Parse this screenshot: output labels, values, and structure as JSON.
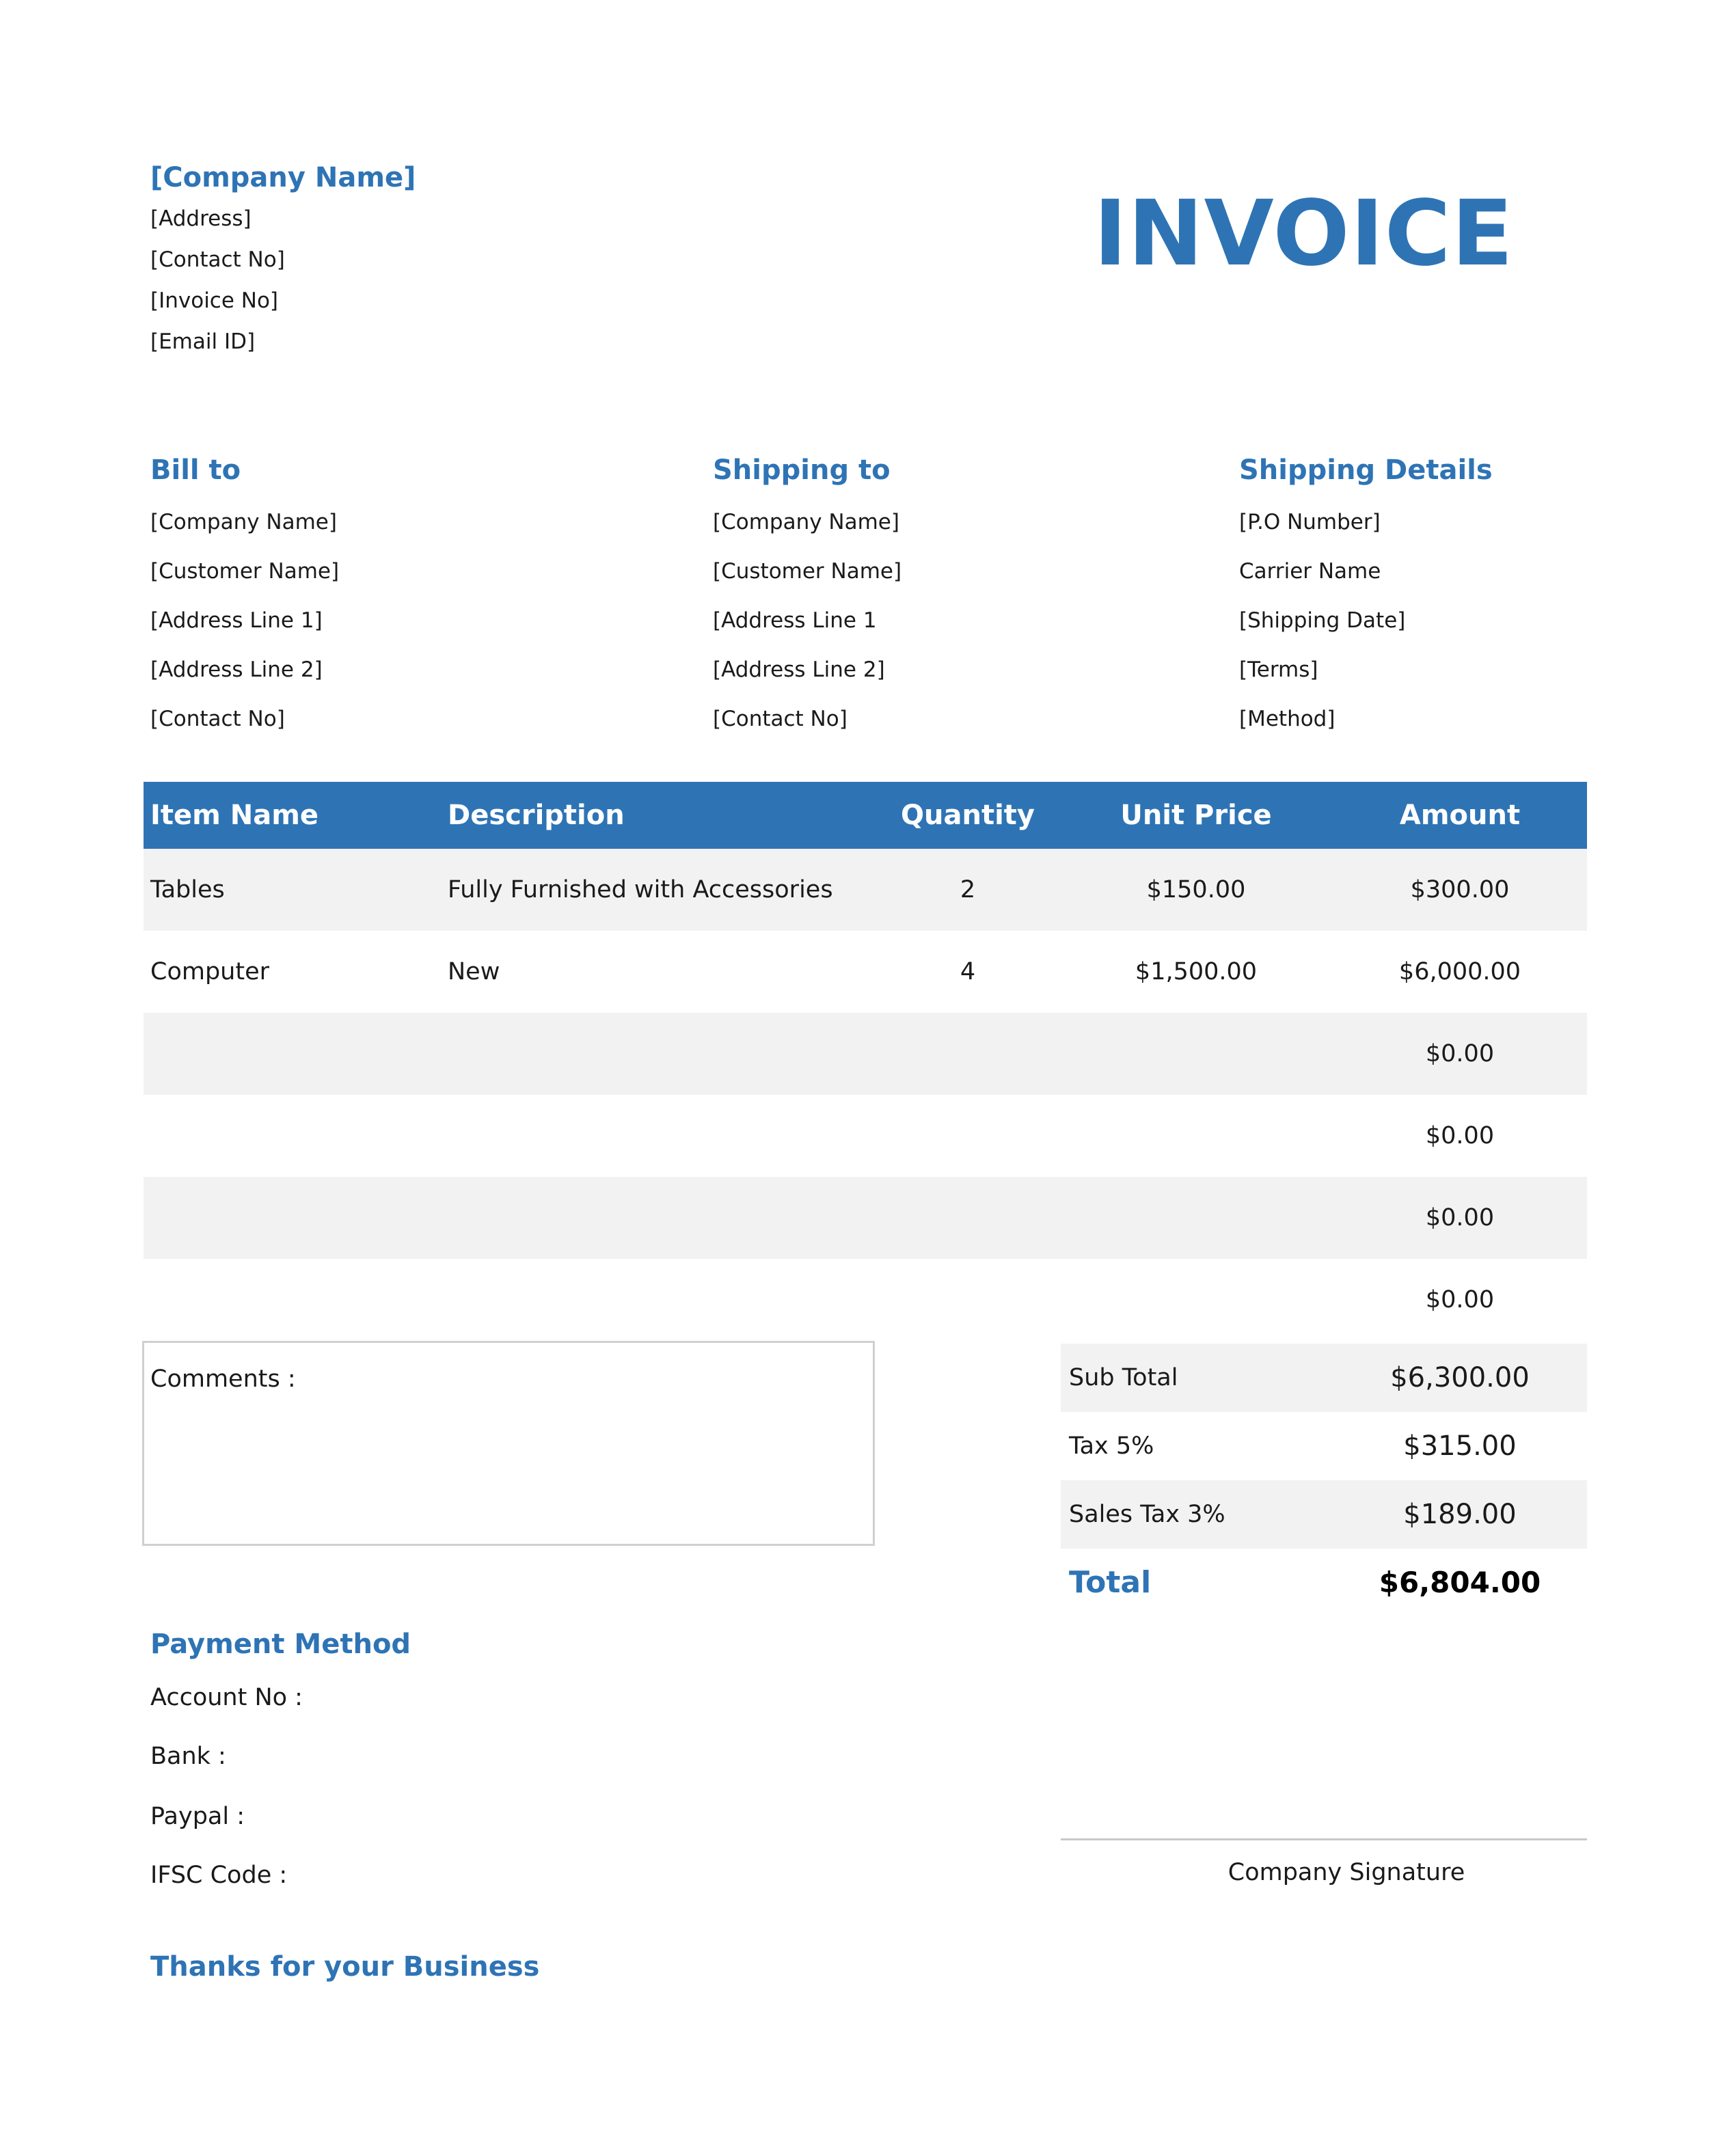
{
  "header": {
    "company_name": "[Company Name]",
    "address": "[Address]",
    "contact": "[Contact No]",
    "invoice_no": "[Invoice No]",
    "email": "[Email ID]",
    "title": "INVOICE"
  },
  "bill_to": {
    "heading": "Bill to",
    "lines": [
      "[Company Name]",
      "[Customer Name]",
      "[Address Line 1]",
      "[Address Line 2]",
      "[Contact No]"
    ]
  },
  "shipping_to": {
    "heading": "Shipping to",
    "lines": [
      "[Company Name]",
      "[Customer Name]",
      "[Address Line 1",
      "[Address Line 2]",
      "[Contact No]"
    ]
  },
  "shipping_details": {
    "heading": "Shipping Details",
    "lines": [
      "[P.O Number]",
      "Carrier Name",
      "[Shipping Date]",
      "[Terms]",
      "[Method]"
    ]
  },
  "table": {
    "headers": [
      "Item Name",
      "Description",
      "Quantity",
      "Unit Price",
      "Amount"
    ],
    "rows": [
      {
        "item": "Tables",
        "description": "Fully Furnished with Accessories",
        "quantity": "2",
        "unit_price": "$150.00",
        "amount": "$300.00"
      },
      {
        "item": "Computer",
        "description": "New",
        "quantity": "4",
        "unit_price": "$1,500.00",
        "amount": "$6,000.00"
      },
      {
        "item": "",
        "description": "",
        "quantity": "",
        "unit_price": "",
        "amount": "$0.00"
      },
      {
        "item": "",
        "description": "",
        "quantity": "",
        "unit_price": "",
        "amount": "$0.00"
      },
      {
        "item": "",
        "description": "",
        "quantity": "",
        "unit_price": "",
        "amount": "$0.00"
      },
      {
        "item": "",
        "description": "",
        "quantity": "",
        "unit_price": "",
        "amount": "$0.00"
      }
    ]
  },
  "comments": {
    "label": "Comments :"
  },
  "summary": {
    "sub_total_label": "Sub Total",
    "sub_total": "$6,300.00",
    "tax_label": "Tax 5%",
    "tax": "$315.00",
    "sales_tax_label": "Sales Tax 3%",
    "sales_tax": "$189.00",
    "total_label": "Total",
    "total": "$6,804.00"
  },
  "payment": {
    "heading": "Payment Method",
    "account": "Account No :",
    "bank": "Bank :",
    "paypal": "Paypal :",
    "ifsc": "IFSC Code :"
  },
  "signature": {
    "label": "Company Signature"
  },
  "footer": {
    "thanks": "Thanks for your Business"
  },
  "colors": {
    "accent": "#2e74b5",
    "row_shade": "#f2f2f2"
  }
}
